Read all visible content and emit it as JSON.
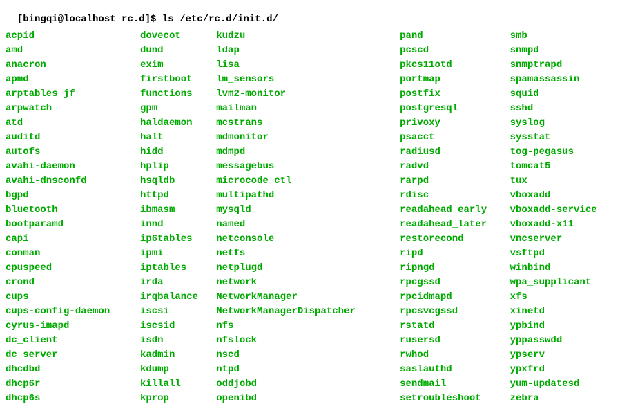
{
  "prompt": {
    "user_host": "[bingqi@localhost rc.d]$",
    "command": "ls /etc/rc.d/init.d/"
  },
  "columns": [
    [
      "acpid",
      "amd",
      "anacron",
      "apmd",
      "arptables_jf",
      "arpwatch",
      "atd",
      "auditd",
      "autofs",
      "avahi-daemon",
      "avahi-dnsconfd",
      "bgpd",
      "bluetooth",
      "bootparamd",
      "capi",
      "conman",
      "cpuspeed",
      "crond",
      "cups",
      "cups-config-daemon",
      "cyrus-imapd",
      "dc_client",
      "dc_server",
      "dhcdbd",
      "dhcp6r",
      "dhcp6s"
    ],
    [
      "dovecot",
      "dund",
      "exim",
      "firstboot",
      "functions",
      "gpm",
      "haldaemon",
      "halt",
      "hidd",
      "hplip",
      "hsqldb",
      "httpd",
      "ibmasm",
      "innd",
      "ip6tables",
      "ipmi",
      "iptables",
      "irda",
      "irqbalance",
      "iscsi",
      "iscsid",
      "isdn",
      "kadmin",
      "kdump",
      "killall",
      "kprop"
    ],
    [
      "kudzu",
      "ldap",
      "lisa",
      "lm_sensors",
      "lvm2-monitor",
      "mailman",
      "mcstrans",
      "mdmonitor",
      "mdmpd",
      "messagebus",
      "microcode_ctl",
      "multipathd",
      "mysqld",
      "named",
      "netconsole",
      "netfs",
      "netplugd",
      "network",
      "NetworkManager",
      "NetworkManagerDispatcher",
      "nfs",
      "nfslock",
      "nscd",
      "ntpd",
      "oddjobd",
      "openibd"
    ],
    [
      "pand",
      "pcscd",
      "pkcs11otd",
      "portmap",
      "postfix",
      "postgresql",
      "privoxy",
      "psacct",
      "radiusd",
      "radvd",
      "rarpd",
      "rdisc",
      "readahead_early",
      "readahead_later",
      "restorecond",
      "ripd",
      "ripngd",
      "rpcgssd",
      "rpcidmapd",
      "rpcsvcgssd",
      "rstatd",
      "rusersd",
      "rwhod",
      "saslauthd",
      "sendmail",
      "setroubleshoot"
    ],
    [
      "smb",
      "snmpd",
      "snmptrapd",
      "spamassassin",
      "squid",
      "sshd",
      "syslog",
      "sysstat",
      "tog-pegasus",
      "tomcat5",
      "tux",
      "vboxadd",
      "vboxadd-service",
      "vboxadd-x11",
      "vncserver",
      "vsftpd",
      "winbind",
      "wpa_supplicant",
      "xfs",
      "xinetd",
      "ypbind",
      "yppasswdd",
      "ypserv",
      "ypxfrd",
      "yum-updatesd",
      "zebra"
    ]
  ]
}
